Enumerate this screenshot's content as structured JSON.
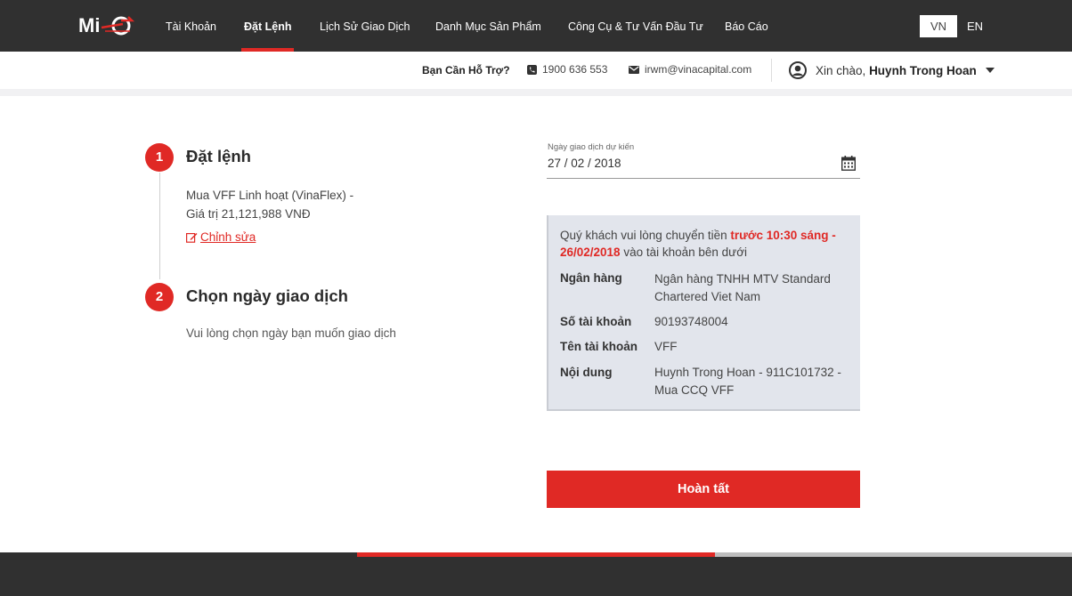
{
  "brand": {
    "logo_text": "Mi",
    "accent": "#e02925",
    "nav_bg": "#303030"
  },
  "nav": {
    "items": [
      {
        "label": "Tài Khoản",
        "active": false
      },
      {
        "label": "Đặt Lệnh",
        "active": true
      },
      {
        "label": "Lịch Sử Giao Dịch",
        "active": false
      },
      {
        "label": "Danh Mục Sản Phẩm",
        "active": false
      },
      {
        "label": "Công Cụ & Tư Vấn Đầu Tư",
        "active": false
      },
      {
        "label": "Báo Cáo",
        "active": false
      }
    ],
    "lang_vn": "VN",
    "lang_en": "EN"
  },
  "support": {
    "label": "Bạn Cần Hỗ Trợ?",
    "phone": "1900 636 553",
    "email": "irwm@vinacapital.com",
    "greeting": "Xin chào,",
    "user_name": "Huynh Trong Hoan"
  },
  "steps": {
    "step1": {
      "number": "1",
      "title": "Đặt lệnh",
      "line1": "Mua VFF Linh hoạt (VinaFlex) -",
      "line2": "Giá trị 21,121,988 VNĐ",
      "edit_label": "Chỉnh sửa"
    },
    "step2": {
      "number": "2",
      "title": "Chọn ngày giao dịch",
      "subtitle": "Vui lòng chọn ngày bạn muốn giao dịch"
    }
  },
  "date": {
    "label": "Ngày giao dịch dự kiến",
    "value": "27 / 02 / 2018"
  },
  "transfer": {
    "notice_prefix": "Quý khách vui lòng chuyển tiền ",
    "notice_highlight": "trước 10:30 sáng - 26/02/2018",
    "notice_suffix": " vào tài khoản bên dưới",
    "rows": [
      {
        "label": "Ngân hàng",
        "value": "Ngân hàng TNHH MTV Standard Chartered Viet Nam"
      },
      {
        "label": "Số tài khoản",
        "value": "90193748004"
      },
      {
        "label": "Tên tài khoản",
        "value": "VFF"
      },
      {
        "label": "Nội dung",
        "value": "Huynh Trong Hoan - 911C101732 - Mua CCQ VFF"
      }
    ]
  },
  "actions": {
    "finish_label": "Hoàn tất"
  }
}
